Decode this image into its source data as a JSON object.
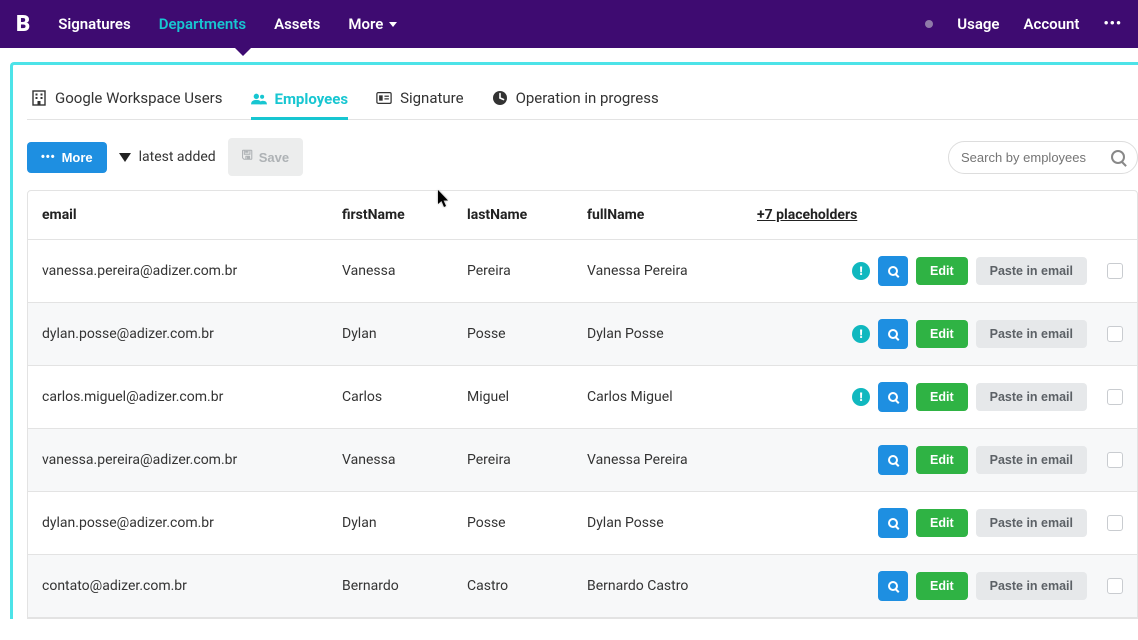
{
  "brand": "B",
  "nav": {
    "signatures": "Signatures",
    "departments": "Departments",
    "assets": "Assets",
    "more": "More",
    "usage": "Usage",
    "account": "Account"
  },
  "tabs": {
    "workspace": "Google Workspace Users",
    "employees": "Employees",
    "signature": "Signature",
    "operation": "Operation in progress"
  },
  "toolbar": {
    "more": "More",
    "filter": "latest added",
    "save": "Save",
    "search_placeholder": "Search by employees"
  },
  "table": {
    "headers": {
      "email": "email",
      "firstName": "firstName",
      "lastName": "lastName",
      "fullName": "fullName",
      "placeholders": "+7 placeholders"
    },
    "actions": {
      "edit": "Edit",
      "paste": "Paste in email"
    },
    "rows": [
      {
        "email": "vanessa.pereira@adizer.com.br",
        "firstName": "Vanessa",
        "lastName": "Pereira",
        "fullName": "Vanessa Pereira",
        "warn": true
      },
      {
        "email": "dylan.posse@adizer.com.br",
        "firstName": "Dylan",
        "lastName": "Posse",
        "fullName": "Dylan Posse",
        "warn": true
      },
      {
        "email": "carlos.miguel@adizer.com.br",
        "firstName": "Carlos",
        "lastName": "Miguel",
        "fullName": "Carlos Miguel",
        "warn": true
      },
      {
        "email": "vanessa.pereira@adizer.com.br",
        "firstName": "Vanessa",
        "lastName": "Pereira",
        "fullName": "Vanessa Pereira",
        "warn": false
      },
      {
        "email": "dylan.posse@adizer.com.br",
        "firstName": "Dylan",
        "lastName": "Posse",
        "fullName": "Dylan Posse",
        "warn": false
      },
      {
        "email": "contato@adizer.com.br",
        "firstName": "Bernardo",
        "lastName": "Castro",
        "fullName": "Bernardo Castro",
        "warn": false
      }
    ]
  }
}
